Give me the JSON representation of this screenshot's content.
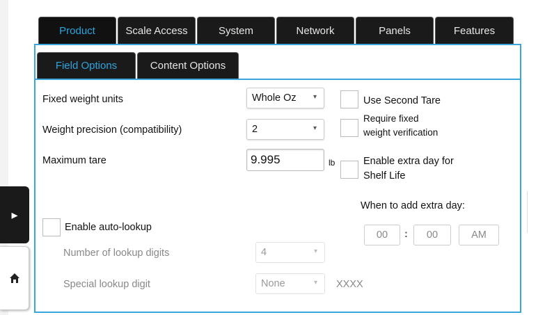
{
  "top_tabs": [
    {
      "label": "Product",
      "active": true
    },
    {
      "label": "Scale Access",
      "active": false
    },
    {
      "label": "System",
      "active": false
    },
    {
      "label": "Network",
      "active": false
    },
    {
      "label": "Panels",
      "active": false
    },
    {
      "label": "Features",
      "active": false
    }
  ],
  "sub_tabs": [
    {
      "label": "Field Options",
      "active": true
    },
    {
      "label": "Content Options",
      "active": false
    }
  ],
  "fields": {
    "fixed_weight_units": {
      "label": "Fixed weight units",
      "value": "Whole Oz"
    },
    "weight_precision": {
      "label": "Weight precision (compatibility)",
      "value": "2"
    },
    "maximum_tare": {
      "label": "Maximum tare",
      "value": "9.995",
      "unit": "lb"
    },
    "use_second_tare": {
      "label": "Use Second Tare",
      "checked": false
    },
    "require_fixed_weight": {
      "label_line1": "Require fixed",
      "label_line2": "weight verification",
      "checked": false
    },
    "enable_extra_day": {
      "label_line1": "Enable extra day for",
      "label_line2": "Shelf Life",
      "checked": false
    },
    "when_to_add": {
      "label": "When to add extra day:",
      "hour": "00",
      "separator": ":",
      "minute": "00",
      "ampm": "AM"
    },
    "enable_auto_lookup": {
      "label": "Enable auto-lookup",
      "checked": false
    },
    "lookup_digits": {
      "label": "Number of lookup digits",
      "value": "4"
    },
    "special_lookup_digit": {
      "label": "Special lookup digit",
      "value": "None",
      "preview": "XXXX"
    }
  },
  "icons": {
    "arrow": "▸",
    "dropdown": "▾",
    "home": "home-icon"
  },
  "colors": {
    "accent": "#3aa7dc",
    "active_tab_text": "#2aa5e0",
    "tab_bg": "#1a1a1a"
  }
}
